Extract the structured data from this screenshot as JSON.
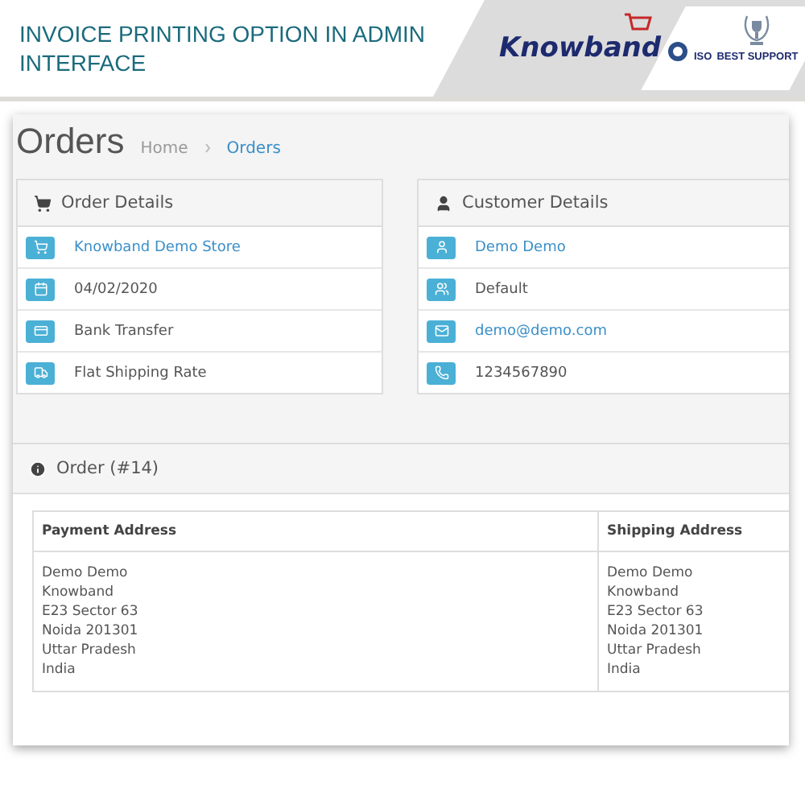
{
  "banner": {
    "title": "INVOICE PRINTING OPTION IN ADMIN INTERFACE",
    "logo": "Knowband",
    "badges": [
      "ISO",
      "BEST SUPPORT"
    ]
  },
  "page": {
    "title": "Orders",
    "breadcrumb": [
      {
        "label": "Home",
        "current": false
      },
      {
        "label": "Orders",
        "current": true
      }
    ]
  },
  "order_details": {
    "title": "Order Details",
    "rows": [
      {
        "kind": "store",
        "text": "Knowband Demo Store",
        "link": true
      },
      {
        "kind": "date",
        "text": "04/02/2020",
        "link": false
      },
      {
        "kind": "payment",
        "text": "Bank Transfer",
        "link": false
      },
      {
        "kind": "shipping",
        "text": "Flat Shipping Rate",
        "link": false
      }
    ]
  },
  "customer_details": {
    "title": "Customer Details",
    "rows": [
      {
        "kind": "customer",
        "text": "Demo Demo",
        "link": true
      },
      {
        "kind": "group",
        "text": "Default",
        "link": false
      },
      {
        "kind": "email",
        "text": "demo@demo.com",
        "link": true
      },
      {
        "kind": "phone",
        "text": "1234567890",
        "link": false
      }
    ]
  },
  "order": {
    "title": "Order (#14)",
    "table": {
      "columns": [
        "Payment Address",
        "Shipping Address"
      ],
      "rows": [
        [
          [
            "Demo Demo",
            "Knowband",
            "E23 Sector 63",
            "Noida 201301",
            "Uttar Pradesh",
            "India"
          ],
          [
            "Demo Demo",
            "Knowband",
            "E23 Sector 63",
            "Noida 201301",
            "Uttar Pradesh",
            "India"
          ]
        ]
      ]
    }
  }
}
